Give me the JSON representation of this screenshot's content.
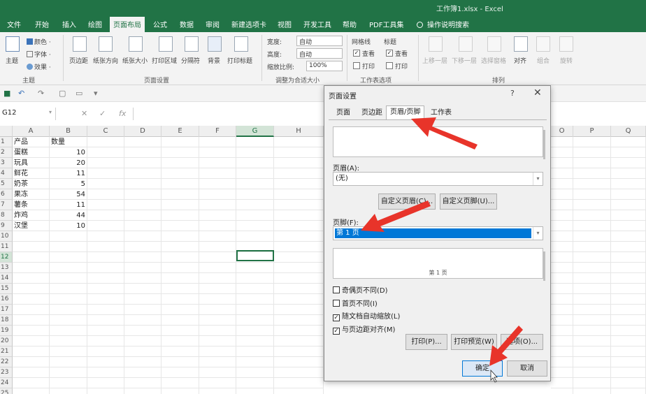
{
  "window": {
    "title": "工作簿1.xlsx  -  Excel"
  },
  "tabs": [
    "文件",
    "开始",
    "插入",
    "绘图",
    "页面布局",
    "公式",
    "数据",
    "审阅",
    "新建选项卡",
    "视图",
    "开发工具",
    "帮助",
    "PDF工具集"
  ],
  "active_tab": "页面布局",
  "search_tab": "操作说明搜索",
  "ribbon": {
    "theme": {
      "themes": "主题",
      "colors": "颜色 ·",
      "fonts": "字体 ·",
      "effects": "效果 ·",
      "group": "主题"
    },
    "page_setup": {
      "margins": "页边距",
      "orientation": "纸张方向",
      "size": "纸张大小",
      "print_area": "打印区域",
      "breaks": "分隔符",
      "background": "背景",
      "print_titles": "打印标题",
      "group": "页面设置"
    },
    "scale": {
      "width_label": "宽度:",
      "width_value": "自动",
      "height_label": "高度:",
      "height_value": "自动",
      "scale_label": "缩放比例:",
      "scale_value": "100%",
      "group": "调整为合适大小"
    },
    "sheet_options": {
      "gridlines": "网格线",
      "headings": "标题",
      "view1": "查看",
      "view2": "查看",
      "print1": "打印",
      "print2": "打印",
      "group": "工作表选项"
    },
    "arrange": {
      "bring_forward": "上移一层",
      "send_backward": "下移一层",
      "selection_pane": "选择窗格",
      "align": "对齐",
      "group_btn": "组合",
      "rotate": "旋转",
      "group": "排列"
    }
  },
  "namebox": "G12",
  "columns": [
    "A",
    "B",
    "C",
    "D",
    "E",
    "F",
    "G",
    "H",
    "O",
    "P",
    "Q"
  ],
  "row_numbers": [
    "1",
    "2",
    "3",
    "4",
    "5",
    "6",
    "7",
    "8",
    "9",
    "10",
    "11",
    "12",
    "13",
    "14",
    "15",
    "16",
    "17",
    "18",
    "19",
    "20",
    "21",
    "22",
    "23",
    "24",
    "25"
  ],
  "sheet": {
    "headers": [
      "产品",
      "数量"
    ],
    "rows": [
      [
        "蛋糕",
        "10"
      ],
      [
        "玩具",
        "20"
      ],
      [
        "鲜花",
        "11"
      ],
      [
        "奶茶",
        "5"
      ],
      [
        "果冻",
        "54"
      ],
      [
        "薯条",
        "11"
      ],
      [
        "炸鸡",
        "44"
      ],
      [
        "汉堡",
        "10"
      ]
    ]
  },
  "dialog": {
    "title": "页面设置",
    "help": "?",
    "close": "✕",
    "tabs": [
      "页面",
      "页边距",
      "页眉/页脚",
      "工作表"
    ],
    "header_label": "页眉(A):",
    "header_value": "(无)",
    "custom_header": "自定义页眉(C)...",
    "custom_footer": "自定义页脚(U)...",
    "footer_label": "页脚(F):",
    "footer_value": "第 1 页",
    "footer_preview": "第 1 页",
    "checks": [
      {
        "label": "奇偶页不同(D)",
        "checked": false
      },
      {
        "label": "首页不同(I)",
        "checked": false
      },
      {
        "label": "随文档自动缩放(L)",
        "checked": true
      },
      {
        "label": "与页边距对齐(M)",
        "checked": true
      }
    ],
    "print": "打印(P)...",
    "print_preview": "打印预览(W)",
    "options": "选项(O)...",
    "ok": "确定",
    "cancel": "取消"
  },
  "colors": {
    "excel_green": "#217346",
    "arrow_red": "#e8342a",
    "selection_blue": "#0078d7"
  }
}
